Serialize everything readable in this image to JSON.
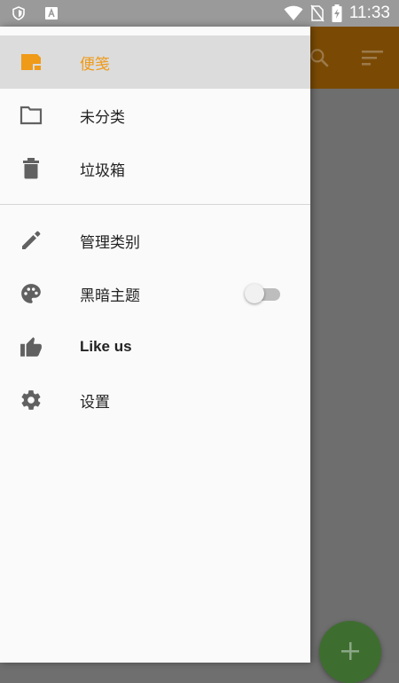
{
  "status_bar": {
    "time": "11:33",
    "icons": [
      "shield-icon",
      "a-icon",
      "wifi-icon",
      "no-sim-icon",
      "battery-charging-icon"
    ]
  },
  "app_bar": {
    "actions": [
      "search-icon",
      "sort-icon"
    ],
    "color": "#7a4a05"
  },
  "drawer": {
    "items": [
      {
        "label": "便笺",
        "icon": "note-icon",
        "selected": true
      },
      {
        "label": "未分类",
        "icon": "folder-icon"
      },
      {
        "label": "垃圾箱",
        "icon": "trash-icon"
      },
      {
        "label": "管理类别",
        "icon": "pencil-icon"
      },
      {
        "label": "黑暗主题",
        "icon": "palette-icon",
        "toggle": false
      },
      {
        "label": "Like us",
        "icon": "thumbs-up-icon"
      },
      {
        "label": "设置",
        "icon": "gear-icon"
      }
    ],
    "accent": "#ef9a18"
  },
  "fab": {
    "icon": "plus-icon",
    "color": "#3e6e2f"
  }
}
